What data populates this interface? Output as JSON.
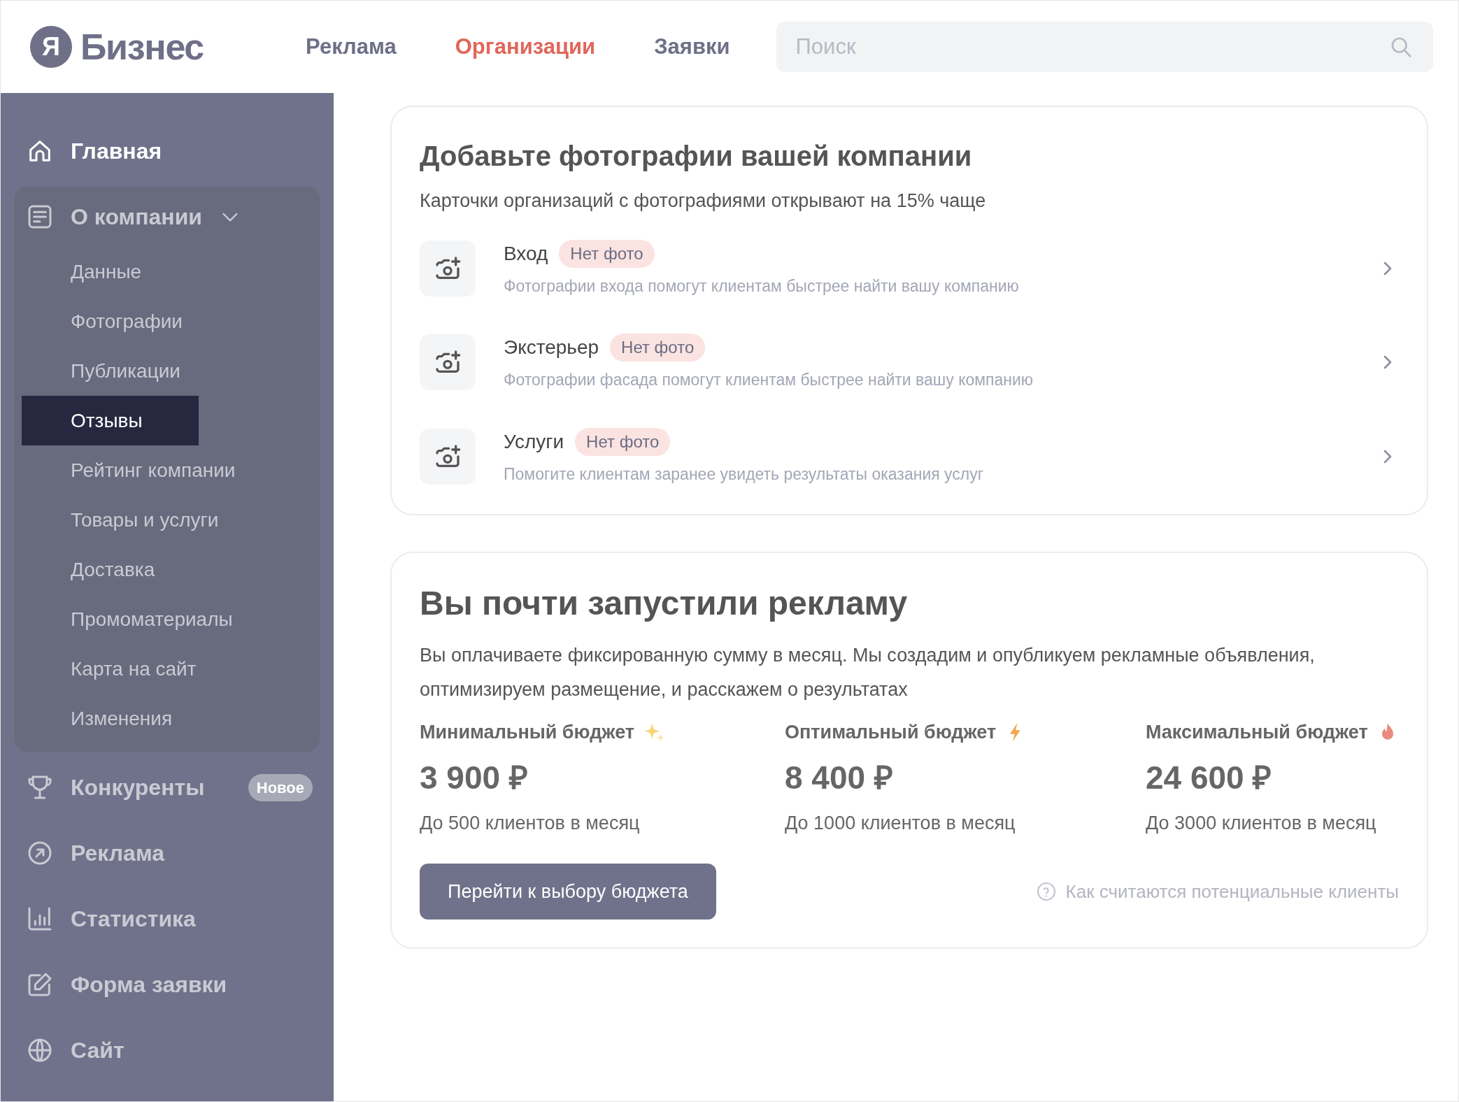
{
  "header": {
    "logo": {
      "mark": "Я",
      "text": "Бизнес"
    },
    "nav": [
      {
        "label": "Реклама",
        "selected": false
      },
      {
        "label": "Организации",
        "selected": true
      },
      {
        "label": "Заявки",
        "selected": false
      }
    ],
    "search": {
      "placeholder": "Поиск"
    }
  },
  "sidebar": {
    "items": [
      {
        "kind": "link",
        "label": "Главная",
        "highlighted": true
      },
      {
        "kind": "group",
        "label": "О компании",
        "expanded": true,
        "children": [
          {
            "label": "Данные",
            "selected": false
          },
          {
            "label": "Фотографии",
            "selected": false
          },
          {
            "label": "Публикации",
            "selected": false
          },
          {
            "label": "Отзывы",
            "selected": true
          },
          {
            "label": "Рейтинг компании",
            "selected": false
          },
          {
            "label": "Товары и услуги",
            "selected": false
          },
          {
            "label": "Доставка",
            "selected": false
          },
          {
            "label": "Промоматериалы",
            "selected": false
          },
          {
            "label": "Карта на сайт",
            "selected": false
          },
          {
            "label": "Изменения",
            "selected": false
          }
        ]
      },
      {
        "kind": "link",
        "label": "Конкуренты",
        "highlighted": false,
        "badge": "Новое"
      },
      {
        "kind": "link",
        "label": "Реклама",
        "highlighted": false
      },
      {
        "kind": "link",
        "label": "Статистика",
        "highlighted": false
      },
      {
        "kind": "link",
        "label": "Форма заявки",
        "highlighted": false
      },
      {
        "kind": "link",
        "label": "Сайт",
        "highlighted": false
      }
    ]
  },
  "photos_card": {
    "title": "Добавьте фотографии вашей компании",
    "subtitle": "Карточки организаций с фотографиями открывают на 15% чаще",
    "rows": [
      {
        "title": "Вход",
        "badge": "Нет фото",
        "description": "Фотографии входа помогут клиентам быстрее найти вашу компанию"
      },
      {
        "title": "Экстерьер",
        "badge": "Нет фото",
        "description": "Фотографии фасада помогут клиентам быстрее найти вашу компанию"
      },
      {
        "title": "Услуги",
        "badge": "Нет фото",
        "description": "Помогите клиентам заранее увидеть результаты оказания услуг"
      }
    ]
  },
  "ads_card": {
    "title": "Вы почти запустили рекламу",
    "description": "Вы оплачиваете фиксированную сумму в месяц. Мы создадим и опубликуем рекламные объявления, оптимизируем размещение, и расскажем о результатах",
    "budgets": [
      {
        "kind": "sparkles",
        "label": "Минимальный бюджет",
        "price": "3 900 ₽",
        "clients": "До 500 клиентов в месяц"
      },
      {
        "kind": "lightning",
        "label": "Оптимальный бюджет",
        "price": "8 400 ₽",
        "clients": "До 1000 клиентов в месяц"
      },
      {
        "kind": "fire",
        "label": "Максимальный бюджет",
        "price": "24 600 ₽",
        "clients": "До 3000 клиентов в месяц"
      }
    ],
    "button": "Перейти к выбору бюджета",
    "help_link": "Как считаются потенциальные клиенты"
  }
}
